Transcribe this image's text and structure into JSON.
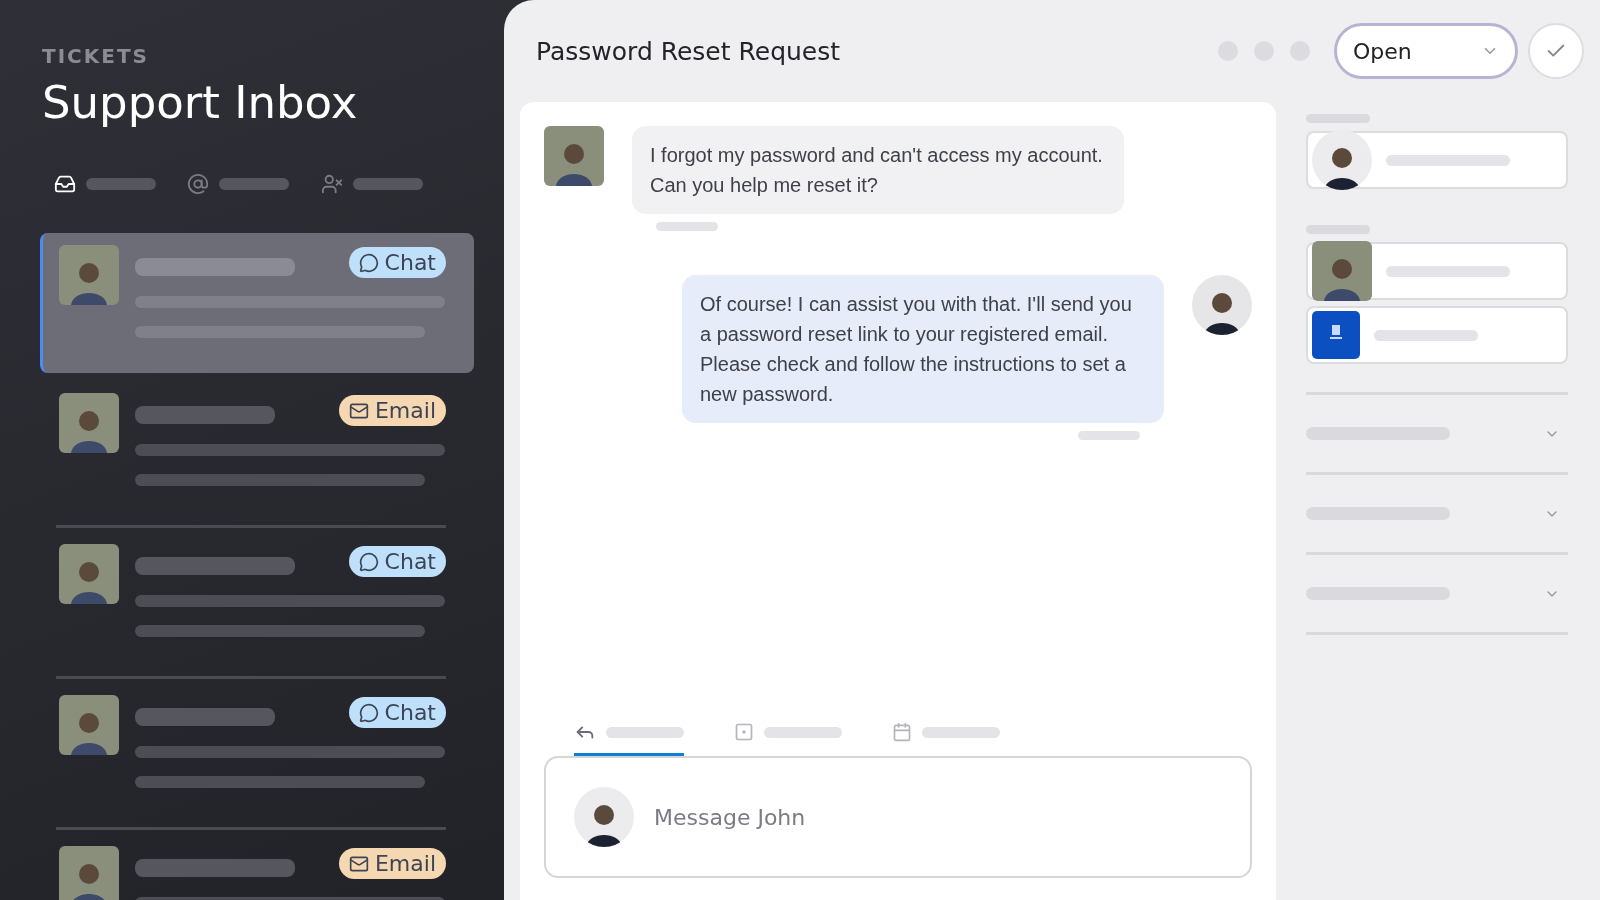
{
  "sidebar": {
    "eyebrow": "TICKETS",
    "title": "Support Inbox",
    "tabs": [
      {
        "selected": true
      },
      {
        "selected": false
      },
      {
        "selected": false
      }
    ],
    "tickets": [
      {
        "kind": "chat",
        "label": "Chat",
        "selected": true
      },
      {
        "kind": "email",
        "label": "Email",
        "selected": false
      },
      {
        "kind": "chat",
        "label": "Chat",
        "selected": false
      },
      {
        "kind": "chat",
        "label": "Chat",
        "selected": false
      },
      {
        "kind": "email",
        "label": "Email",
        "selected": false
      }
    ]
  },
  "conversation": {
    "title": "Password Reset Request",
    "status": "Open",
    "messages": [
      {
        "kind": "incoming",
        "text": "I forgot my password and can't access my account. Can you help me reset it?"
      },
      {
        "kind": "outgoing",
        "text": "Of course! I can assist you with that. I'll send you a password reset link to your registered email. Please check and follow the instructions to set a new password."
      }
    ],
    "composer_tabs": [
      {
        "selected": true
      },
      {
        "selected": false
      },
      {
        "selected": false
      }
    ],
    "composer": {
      "placeholder": "Message John"
    }
  }
}
